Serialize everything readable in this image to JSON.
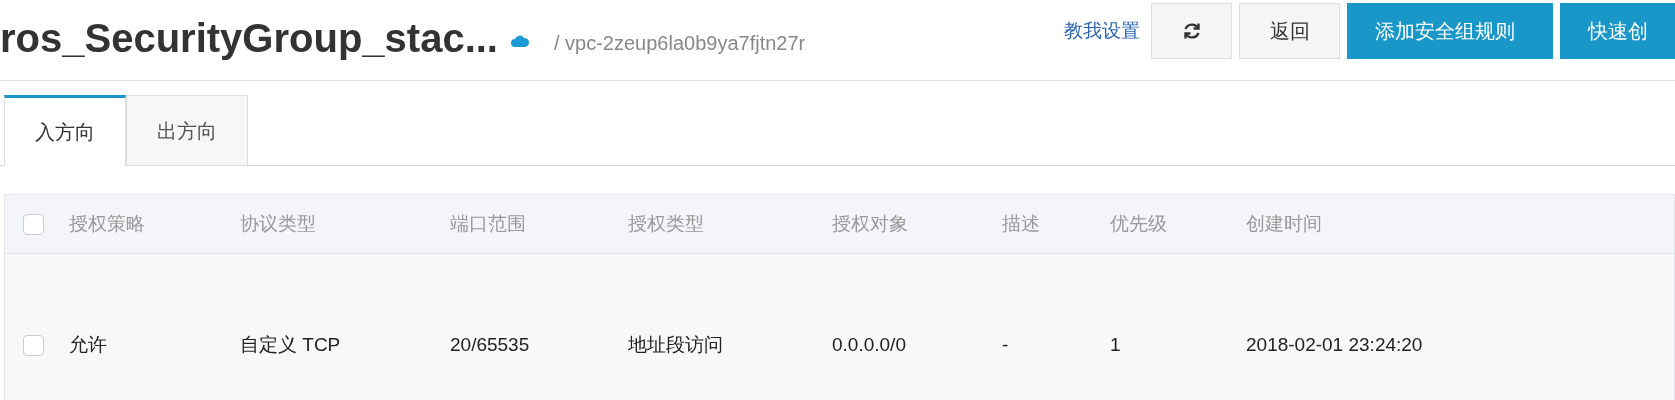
{
  "header": {
    "title": "ros_SecurityGroup_stac...",
    "vpc": "/ vpc-2zeup6la0b9ya7fjtn27r",
    "help_link": "教我设置",
    "buttons": [
      {
        "kind": "refresh"
      },
      {
        "kind": "default",
        "label": "返回"
      },
      {
        "kind": "primary",
        "label": "添加安全组规则"
      },
      {
        "kind": "primary",
        "label": "快速创"
      }
    ]
  },
  "tabs": [
    {
      "label": "入方向",
      "selected": true
    },
    {
      "label": "出方向",
      "selected": false
    }
  ],
  "table": {
    "select_all_checked": false,
    "columns": [
      "授权策略",
      "协议类型",
      "端口范围",
      "授权类型",
      "授权对象",
      "描述",
      "优先级",
      "创建时间"
    ],
    "rows": [
      {
        "checked": false,
        "cells": [
          "允许",
          "自定义 TCP",
          "20/65535",
          "地址段访问",
          "0.0.0.0/0",
          "-",
          "1",
          "2018-02-01 23:24:20"
        ]
      }
    ]
  }
}
